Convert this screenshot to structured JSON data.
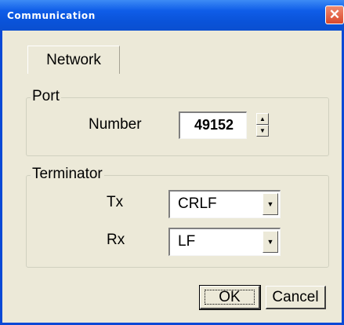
{
  "window": {
    "title": "Communication",
    "close_glyph": "✕",
    "close_icon": "close-icon"
  },
  "tab": {
    "label": "Network"
  },
  "port": {
    "group_label": "Port",
    "number_label": "Number",
    "number_value": "49152"
  },
  "terminator": {
    "group_label": "Terminator",
    "tx_label": "Tx",
    "tx_value": "CRLF",
    "rx_label": "Rx",
    "rx_value": "LF"
  },
  "buttons": {
    "ok": "OK",
    "cancel": "Cancel"
  }
}
